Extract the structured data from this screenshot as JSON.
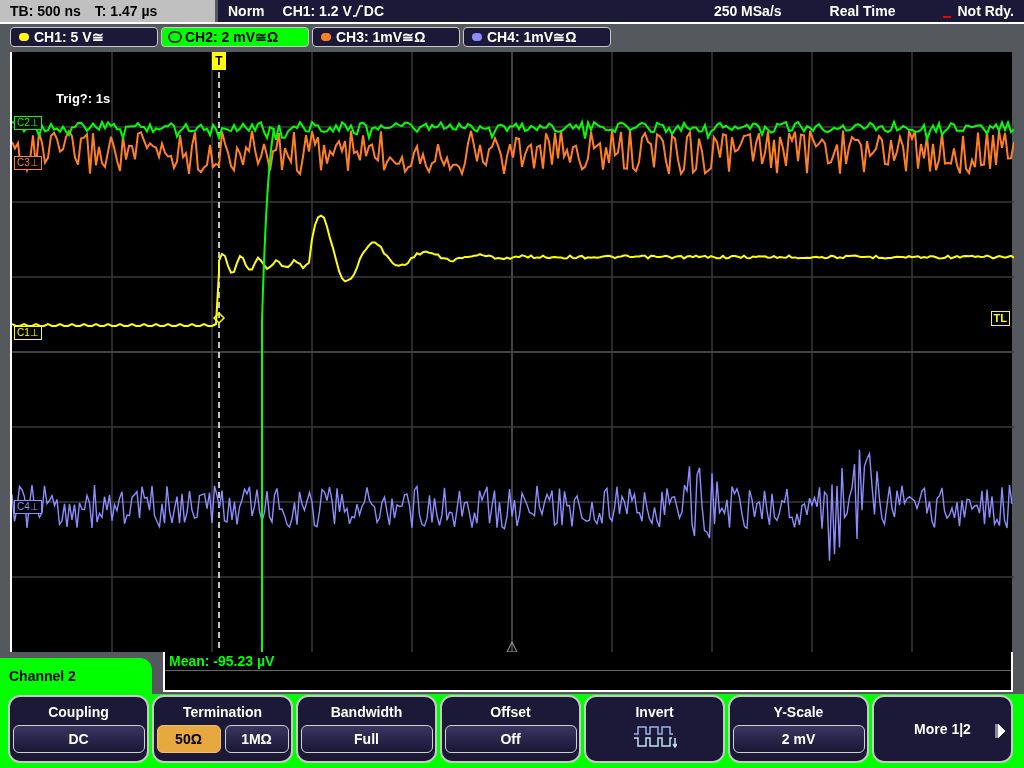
{
  "status_bar": {
    "timebase": "TB: 500 ns",
    "trigger_time": "T: 1.47 µs",
    "trigger_mode": "Norm",
    "trigger_source": "CH1: 1.2 V",
    "trigger_coupling": "DC",
    "sample_rate": "250 MSa/s",
    "acquisition": "Real Time",
    "state": "Not Rdy."
  },
  "channels": [
    {
      "label": "CH1: 5 V≅",
      "color": "#ffff00",
      "selected": false
    },
    {
      "label": "CH2: 2 mV≅Ω",
      "color": "#00ff00",
      "selected": true
    },
    {
      "label": "CH3: 1mV≅Ω",
      "color": "#ff7f27",
      "selected": false
    },
    {
      "label": "CH4: 1mV≅Ω",
      "color": "#8c8cff",
      "selected": false
    }
  ],
  "plot": {
    "trigger_info": "Trig?: 1s",
    "trigger_marker": "T",
    "trigger_level_marker": "TL",
    "markers": [
      {
        "label": "C2⊥",
        "color": "#00ff00"
      },
      {
        "label": "C3⊥",
        "color": "#ff7f27"
      },
      {
        "label": "C1⊥",
        "color": "#ffff00"
      },
      {
        "label": "C4⊥",
        "color": "#8c8cff"
      }
    ]
  },
  "measurement": {
    "text": "Mean: -95.23 µV"
  },
  "menu": {
    "title": "Channel 2",
    "softkeys": [
      {
        "kind": "value",
        "title": "Coupling",
        "value": "DC"
      },
      {
        "kind": "toggle",
        "title": "Termination",
        "options": [
          {
            "label": "50Ω",
            "selected": true
          },
          {
            "label": "1MΩ",
            "selected": false
          }
        ]
      },
      {
        "kind": "value",
        "title": "Bandwidth",
        "value": "Full"
      },
      {
        "kind": "value",
        "title": "Offset",
        "value": "Off"
      },
      {
        "kind": "icon",
        "title": "Invert"
      },
      {
        "kind": "value",
        "title": "Y-Scale",
        "value": "2 mV"
      },
      {
        "kind": "next",
        "title": "More 1|2"
      }
    ]
  }
}
